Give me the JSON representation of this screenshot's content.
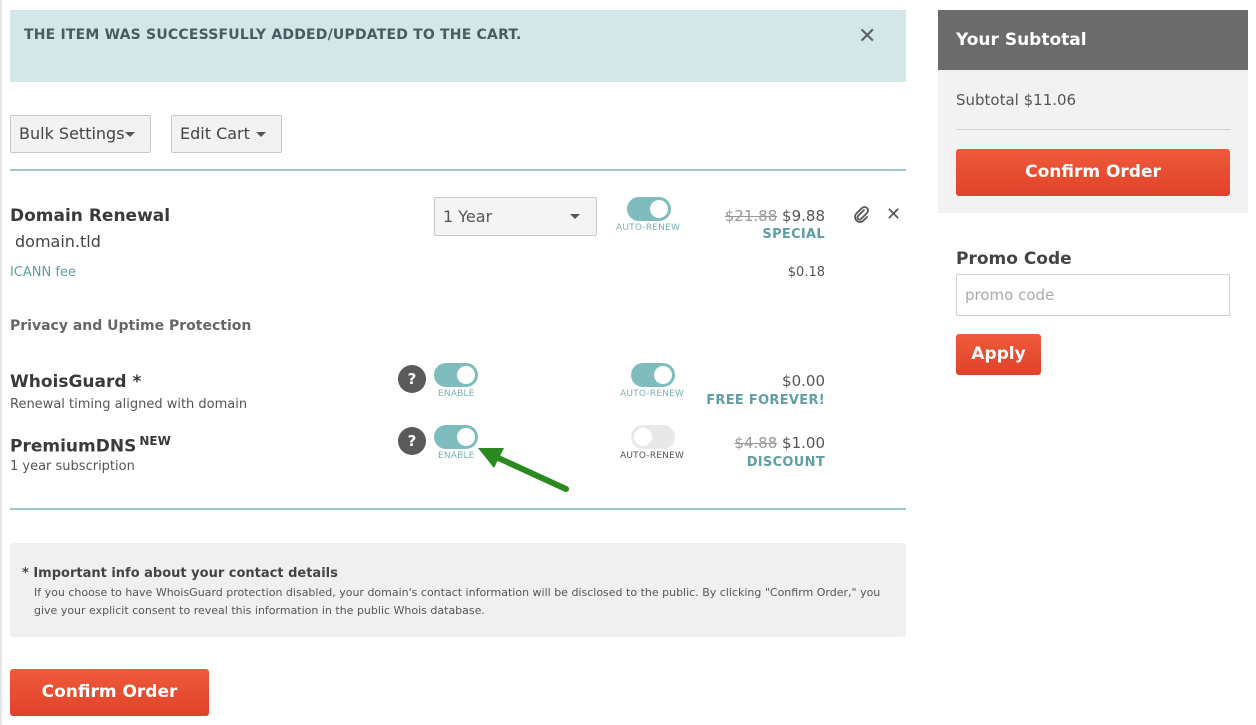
{
  "alert": {
    "message": "THE ITEM WAS SUCCESSFULLY ADDED/UPDATED TO THE CART.",
    "close_glyph": "✕"
  },
  "toolbar": {
    "bulk_settings_label": "Bulk Settings",
    "edit_cart_label": "Edit Cart"
  },
  "domain_item": {
    "title": "Domain Renewal",
    "domain": "domain.tld",
    "period_selected": "1 Year",
    "auto_renew_label": "AUTO-RENEW",
    "auto_renew_on": true,
    "old_price": "$21.88",
    "price": "$9.88",
    "tag": "SPECIAL",
    "icann_label": "ICANN fee",
    "icann_price": "$0.18",
    "edit_icon": "paperclip-icon",
    "remove_glyph": "✕"
  },
  "protection_heading": "Privacy and Uptime Protection",
  "whoisguard": {
    "title": "WhoisGuard *",
    "subtitle": "Renewal timing aligned with domain",
    "help_glyph": "?",
    "enable_label": "ENABLE",
    "enabled": true,
    "auto_renew_label": "AUTO-RENEW",
    "auto_renew_on": true,
    "price": "$0.00",
    "tag": "FREE FOREVER!"
  },
  "premiumdns": {
    "title": "PremiumDNS",
    "badge": "NEW",
    "subtitle": "1 year subscription",
    "help_glyph": "?",
    "enable_label": "ENABLE",
    "enabled": true,
    "auto_renew_label": "AUTO-RENEW",
    "auto_renew_on": false,
    "old_price": "$4.88",
    "price": "$1.00",
    "tag": "DISCOUNT"
  },
  "info": {
    "title": "* Important info about your contact details",
    "body": "If you choose to have WhoisGuard protection disabled, your domain's contact information will be disclosed to the public. By clicking \"Confirm Order,\" you give your explicit consent to reveal this information in the public Whois database."
  },
  "confirm_order_label": "Confirm Order",
  "sidebar": {
    "heading": "Your Subtotal",
    "subtotal": "Subtotal $11.06",
    "confirm_order_label": "Confirm Order",
    "promo_label": "Promo Code",
    "promo_placeholder": "promo code",
    "promo_value": "",
    "apply_label": "Apply"
  },
  "colors": {
    "accent_teal": "#7fbcbd",
    "brand_red": "#e44b2d",
    "annotation_green": "#2a8a1f"
  }
}
